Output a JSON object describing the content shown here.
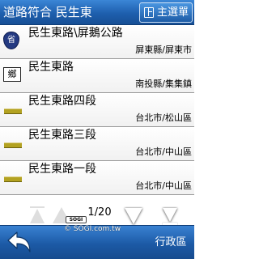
{
  "header": {
    "title": "道路符合 民生東",
    "menu_label": "主選單"
  },
  "results": [
    {
      "name": "民生東路\\屏鵝公路",
      "region": "屏東縣/屏東市",
      "road_class": "provincial",
      "badge": "省"
    },
    {
      "name": "民生東路",
      "region": "南投縣/集集鎮",
      "road_class": "township",
      "badge": "鄉"
    },
    {
      "name": "民生東路四段",
      "region": "台北市/松山區",
      "road_class": "local",
      "badge": ""
    },
    {
      "name": "民生東路三段",
      "region": "台北市/中山區",
      "road_class": "local",
      "badge": ""
    },
    {
      "name": "民生東路一段",
      "region": "台北市/中山區",
      "road_class": "local",
      "badge": ""
    }
  ],
  "pager": {
    "page_text": "1/20"
  },
  "footer": {
    "district_label": "行政區",
    "watermark_badge": "SOGI",
    "watermark_text": "© SOGI.com.tw"
  },
  "colors": {
    "header_blue": "#1e5fae",
    "footer_blue": "#1c5aa6",
    "provincial_badge": "#243a82",
    "local_road_bar": "#b3a221"
  },
  "icons": {
    "menu": "grid-icon",
    "back": "back-arrow-icon",
    "pager": [
      "first-page-icon",
      "prev-page-icon",
      "next-page-icon",
      "last-page-icon"
    ]
  }
}
